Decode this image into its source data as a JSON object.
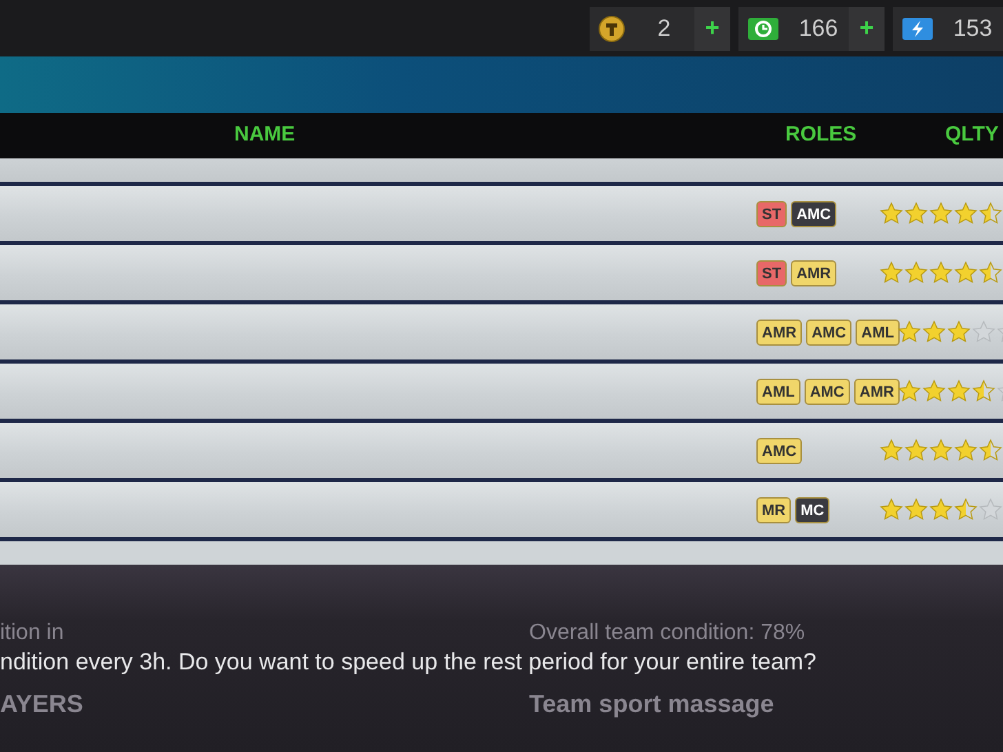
{
  "currencies": [
    {
      "kind": "coin",
      "value": "2",
      "plus": "+"
    },
    {
      "kind": "cash",
      "value": "166",
      "plus": "+"
    },
    {
      "kind": "energy",
      "value": "153"
    }
  ],
  "table": {
    "columns": [
      "NAME",
      "ROLES",
      "QLTY"
    ],
    "rows": [
      {
        "roles": [
          {
            "label": "ST",
            "color": "#e86868"
          },
          {
            "label": "AMC",
            "color": "#3a3a40"
          }
        ],
        "stars": 4.5
      },
      {
        "roles": [
          {
            "label": "ST",
            "color": "#e86868"
          },
          {
            "label": "AMR",
            "color": "#f0d66a"
          }
        ],
        "stars": 4.5
      },
      {
        "roles": [
          {
            "label": "AMR",
            "color": "#f0d66a"
          },
          {
            "label": "AMC",
            "color": "#f0d66a"
          },
          {
            "label": "AML",
            "color": "#f0d66a"
          }
        ],
        "stars": 3
      },
      {
        "roles": [
          {
            "label": "AML",
            "color": "#f0d66a"
          },
          {
            "label": "AMC",
            "color": "#f0d66a"
          },
          {
            "label": "AMR",
            "color": "#f0d66a"
          }
        ],
        "stars": 3.5
      },
      {
        "roles": [
          {
            "label": "AMC",
            "color": "#f0d66a"
          }
        ],
        "stars": 4.5
      },
      {
        "roles": [
          {
            "label": "MR",
            "color": "#f0d66a"
          },
          {
            "label": "MC",
            "color": "#3a3a40"
          }
        ],
        "stars": 3.5
      }
    ]
  },
  "background": {
    "left_caption": "ition in",
    "left_heading": "AYERS",
    "right_caption": "Overall team condition: 78%",
    "right_heading": "Team sport massage"
  },
  "dialog": {
    "message": "ndition every 3h. Do you want to speed up the rest period for your entire team?"
  }
}
